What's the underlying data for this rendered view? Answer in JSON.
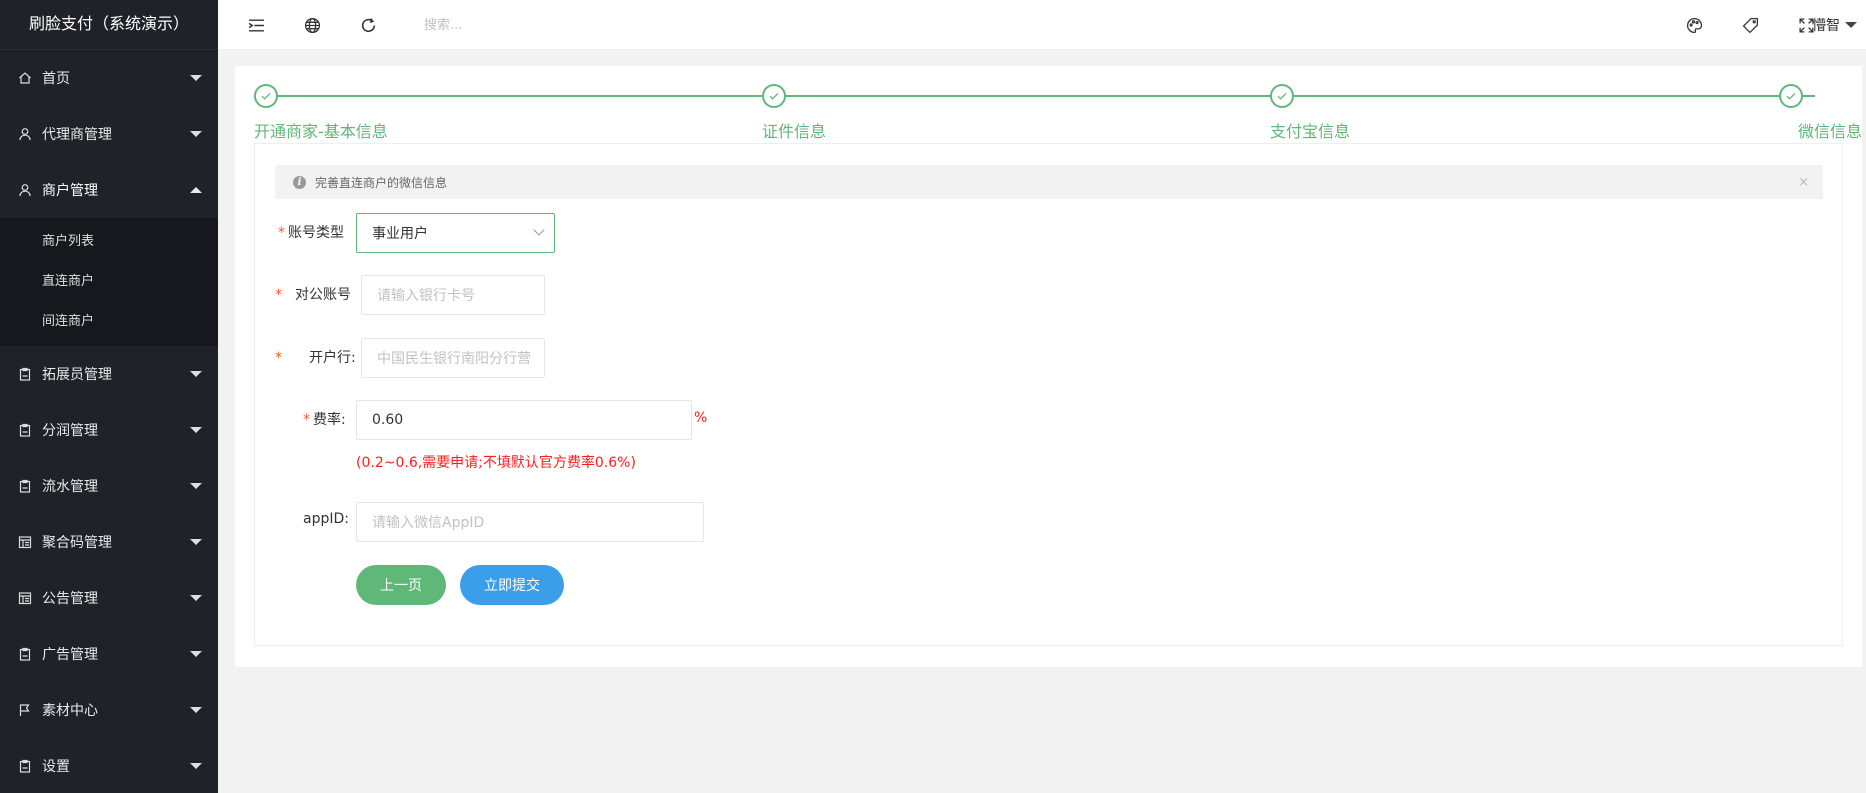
{
  "app": {
    "title": "刷脸支付（系统演示）"
  },
  "sidebar": {
    "items": [
      {
        "label": "首页",
        "icon": "home-icon"
      },
      {
        "label": "代理商管理",
        "icon": "user-icon"
      },
      {
        "label": "商户管理",
        "icon": "user-icon",
        "open": true,
        "children": [
          "商户列表",
          "直连商户",
          "间连商户"
        ]
      },
      {
        "label": "拓展员管理",
        "icon": "clipboard-icon"
      },
      {
        "label": "分润管理",
        "icon": "clipboard-icon"
      },
      {
        "label": "流水管理",
        "icon": "clipboard-icon"
      },
      {
        "label": "聚合码管理",
        "icon": "template-icon"
      },
      {
        "label": "公告管理",
        "icon": "template-icon"
      },
      {
        "label": "广告管理",
        "icon": "clipboard-icon"
      },
      {
        "label": "素材中心",
        "icon": "flag-icon"
      },
      {
        "label": "设置",
        "icon": "clipboard-icon"
      }
    ]
  },
  "header": {
    "search_placeholder": "搜索...",
    "username": "懵智",
    "icons": [
      "menu-toggle-icon",
      "website-icon",
      "refresh-icon",
      "theme-icon",
      "note-icon",
      "fullscreen-icon"
    ]
  },
  "steps": [
    {
      "label": "开通商家-基本信息"
    },
    {
      "label": "证件信息"
    },
    {
      "label": "支付宝信息"
    },
    {
      "label": "微信信息"
    }
  ],
  "tip": {
    "text": "完善直连商户的微信信息",
    "close": "×"
  },
  "form": {
    "account_type": {
      "label": "账号类型",
      "required": "*",
      "value": "事业用户"
    },
    "account_no": {
      "label": "对公账号",
      "required": "*",
      "placeholder": "请输入银行卡号"
    },
    "bank": {
      "label": "开户行:",
      "required": "*",
      "placeholder": "中国民生银行南阳分行营"
    },
    "rate": {
      "label": "费率:",
      "required": "*",
      "value": "0.60",
      "unit": "%",
      "hint": "(0.2~0.6,需要申请;不填默认官方费率0.6%)"
    },
    "appid": {
      "label": "appID:",
      "placeholder": "请输入微信AppID"
    }
  },
  "buttons": {
    "prev": "上一页",
    "submit": "立即提交"
  },
  "colors": {
    "sidebar_bg": "#20222a",
    "accent_green": "#5fb878",
    "submit_blue": "#3a9fe8",
    "error_red": "#ff1e1e"
  }
}
